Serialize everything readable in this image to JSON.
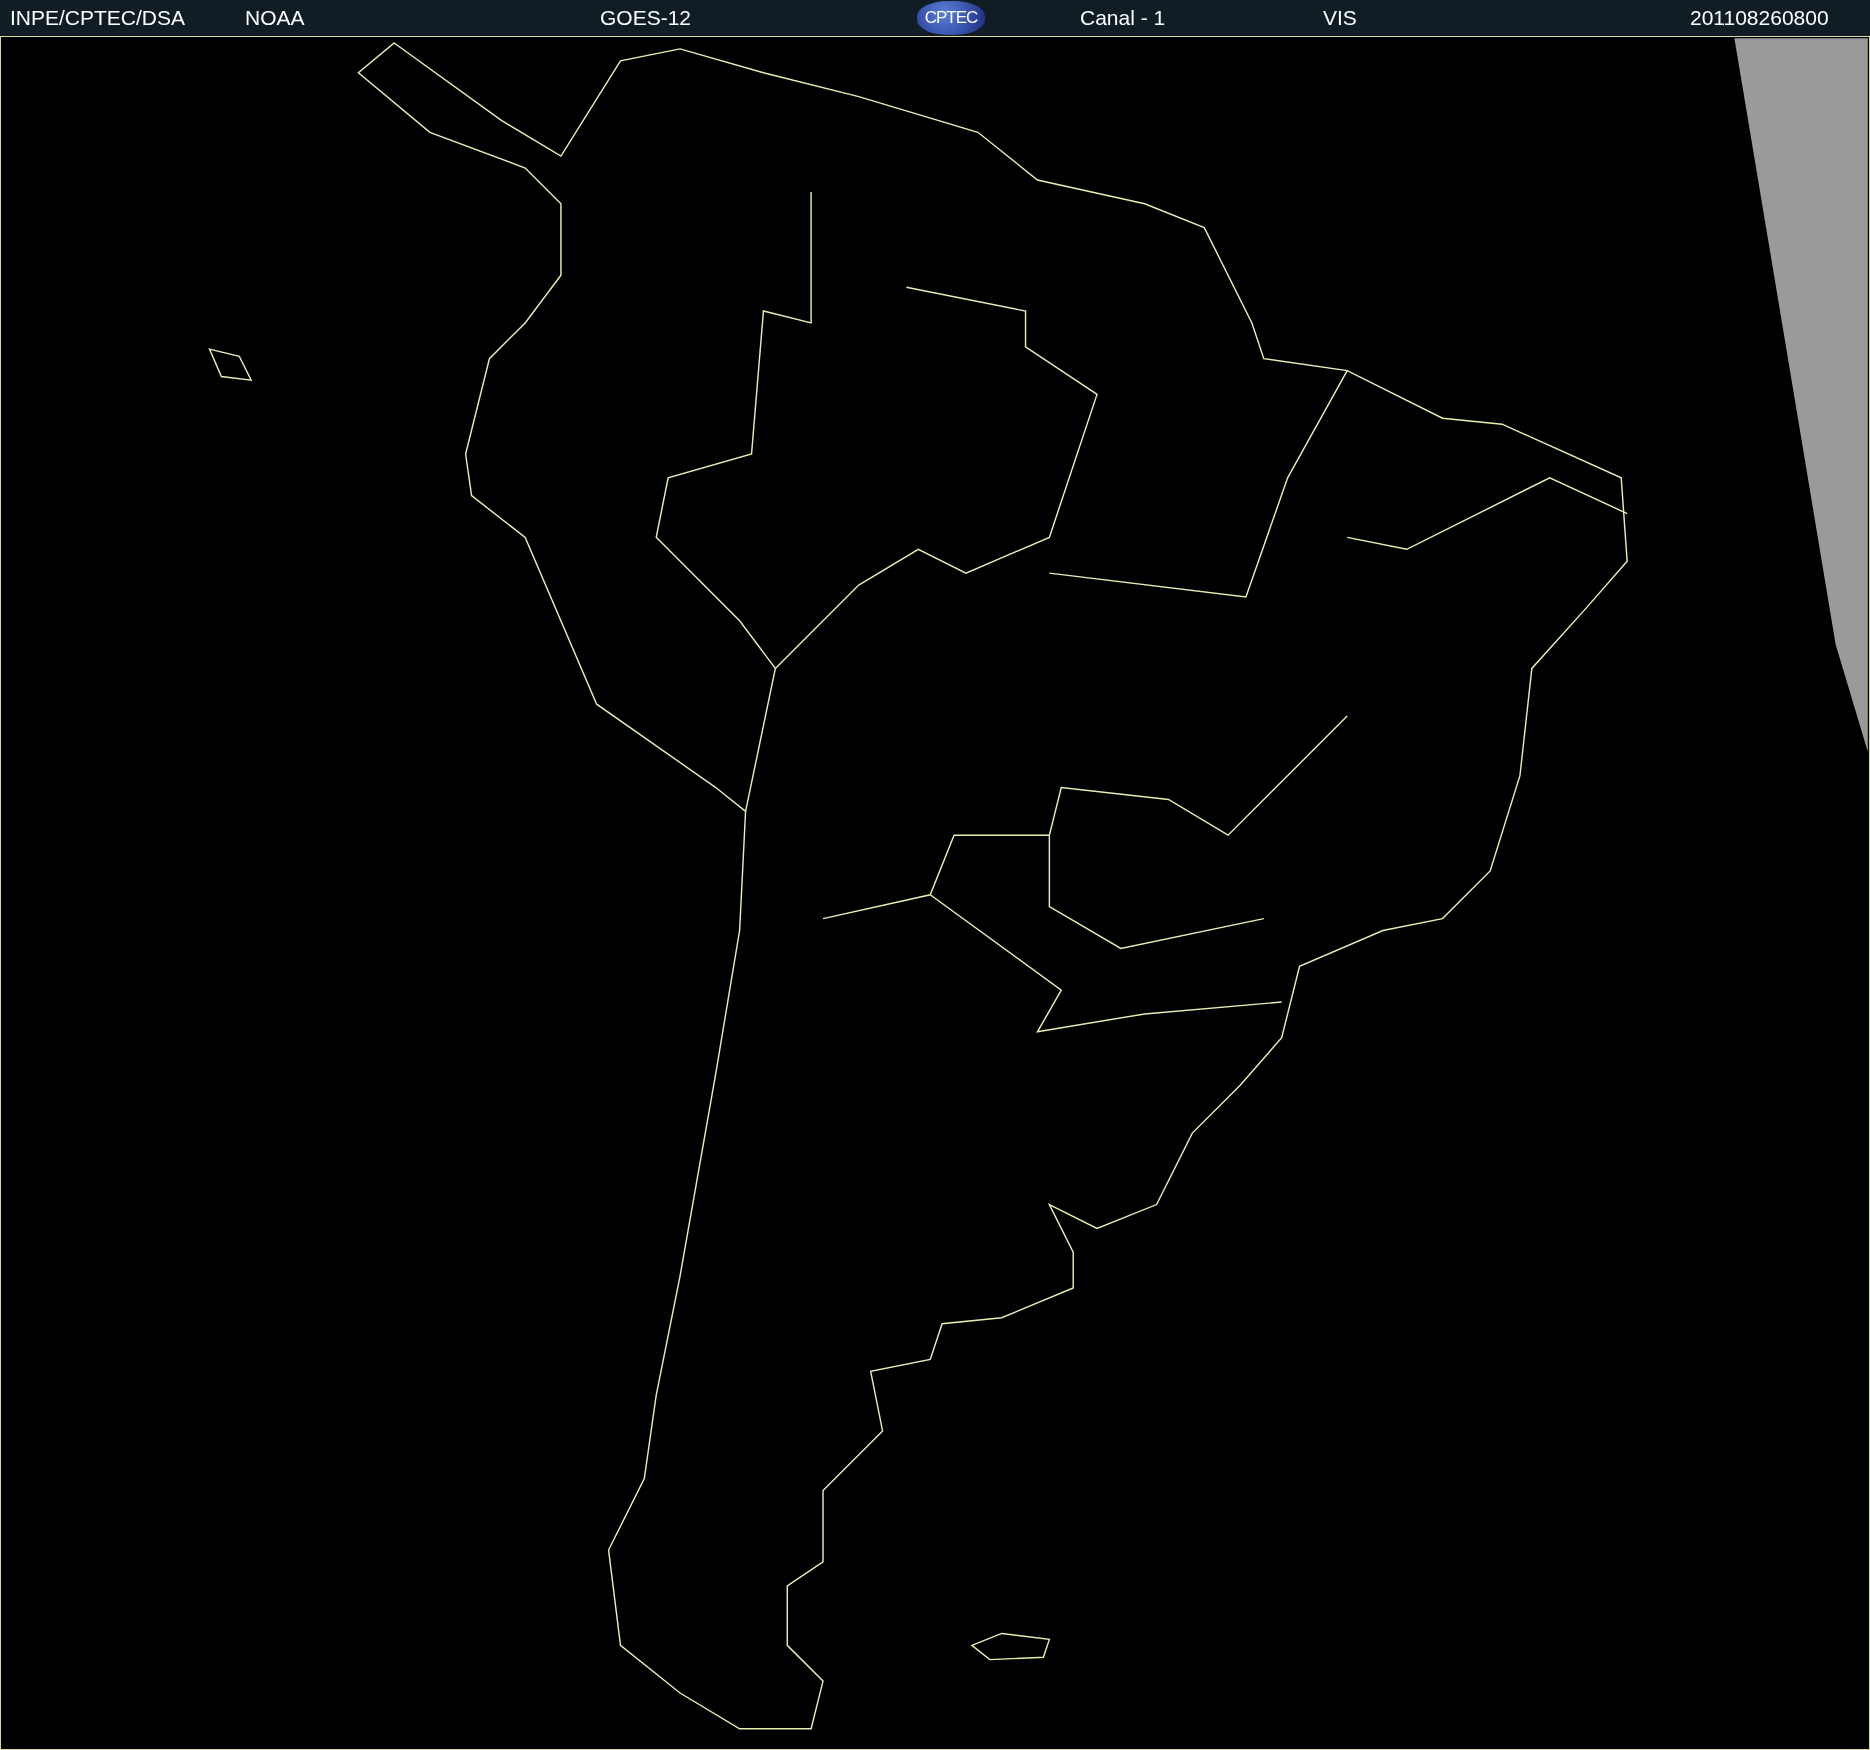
{
  "header": [
    {
      "kind": "label",
      "text": "INPE/CPTEC/DSA"
    },
    {
      "kind": "label",
      "text": "NOAA"
    },
    {
      "kind": "label",
      "text": "GOES-12"
    },
    {
      "kind": "logo",
      "text": "CPTEC"
    },
    {
      "kind": "label",
      "text": "Canal - 1"
    },
    {
      "kind": "label",
      "text": "VIS"
    },
    {
      "kind": "label",
      "text": "201108260800"
    }
  ]
}
